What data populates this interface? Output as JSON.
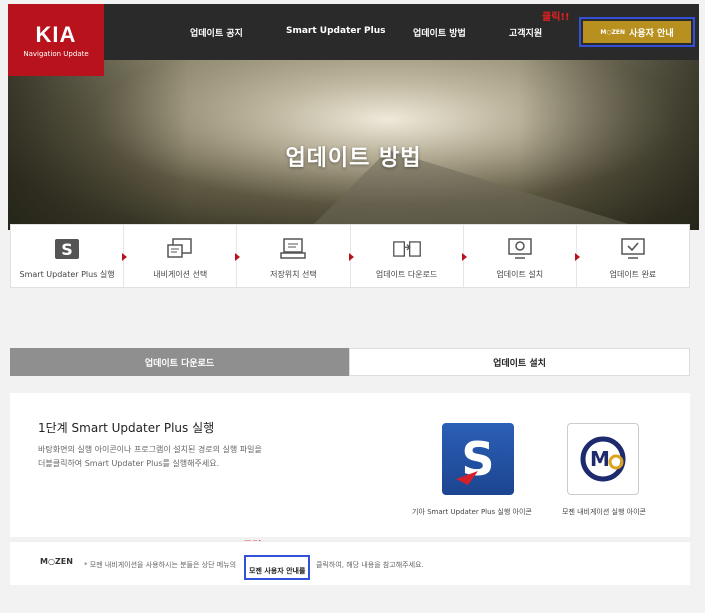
{
  "header": {
    "logo_main": "KIA",
    "logo_sub": "Navigation Update",
    "nav": [
      "업데이트 공지",
      "Smart Updater Plus",
      "업데이트 방법",
      "고객지원"
    ],
    "mozen_button_logo": "M○ZEN",
    "mozen_button_label": "사용자 안내",
    "click_annotation": "클릭!!"
  },
  "hero": {
    "title": "업데이트 방법"
  },
  "steps": [
    {
      "label": "Smart Updater Plus 실행",
      "icon": "smart-updater-icon"
    },
    {
      "label": "내비게이션 선택",
      "icon": "navigation-select-icon"
    },
    {
      "label": "저장위치 선택",
      "icon": "storage-select-icon"
    },
    {
      "label": "업데이트 다운로드",
      "icon": "download-icon"
    },
    {
      "label": "업데이트 설치",
      "icon": "install-icon"
    },
    {
      "label": "업데이트 완료",
      "icon": "complete-icon"
    }
  ],
  "tabs": {
    "download": "업데이트 다운로드",
    "install": "업데이트 설치"
  },
  "content": {
    "title": "1단계 Smart Updater Plus 실행",
    "desc_line1": "바탕화면의 실행 아이콘이나 프로그램이 설치된 경로의 실행 파일을",
    "desc_line2": "더블클릭하여 Smart Updater Plus를 실행해주세요.",
    "caption_s": "기아 Smart Updater Plus 실행 아이콘",
    "caption_m": "모젠 내비게이션 실행 아이콘",
    "icon_s_letter": "S",
    "icon_m_letter": "M"
  },
  "note": {
    "logo": "M○ZEN",
    "text_before": "* 모젠 내비게이션을 사용하시는 분들은 상단 메뉴의",
    "highlight": "모젠 사용자 안내를",
    "text_after": "클릭하여, 해당 내용을 참고해주세요.",
    "click_annotation": "클릭!!"
  },
  "colors": {
    "brand_red": "#b8131c",
    "mozen_gold": "#b8901f",
    "highlight_blue": "#3350d8",
    "annotation_red": "#e02020"
  }
}
